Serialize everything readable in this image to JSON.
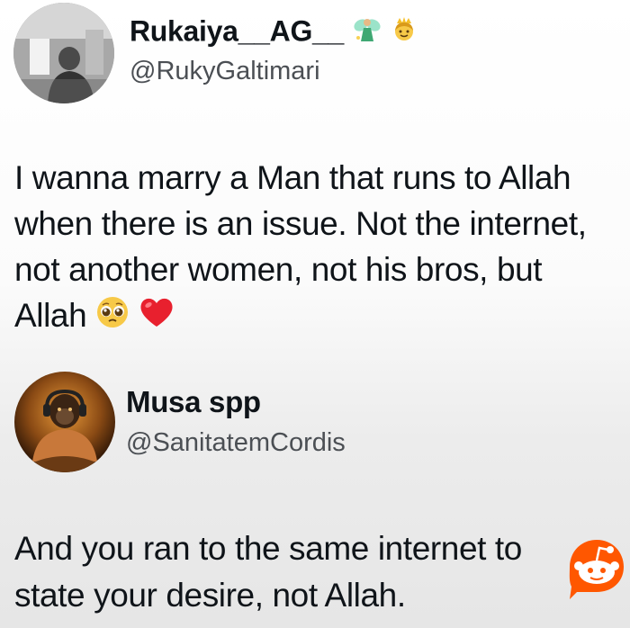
{
  "tweet1": {
    "display_name": "Rukaiya__AG__",
    "name_emojis": [
      "fairy-emoji",
      "princess-emoji"
    ],
    "handle": "@RukyGaltimari",
    "lines": [
      "I wanna marry a Man that runs to Allah",
      "when there is an issue. Not the internet,",
      "not another women, not his bros, but",
      "Allah"
    ],
    "end_emojis": [
      "pleading-face-emoji",
      "red-heart-emoji"
    ]
  },
  "tweet2": {
    "display_name": "Musa spp",
    "handle": "@SanitatemCordis",
    "lines": [
      "And you ran to the same internet to",
      "state your desire, not Allah."
    ]
  },
  "watermark": {
    "icon": "reddit-icon",
    "color": "#ff5700"
  }
}
